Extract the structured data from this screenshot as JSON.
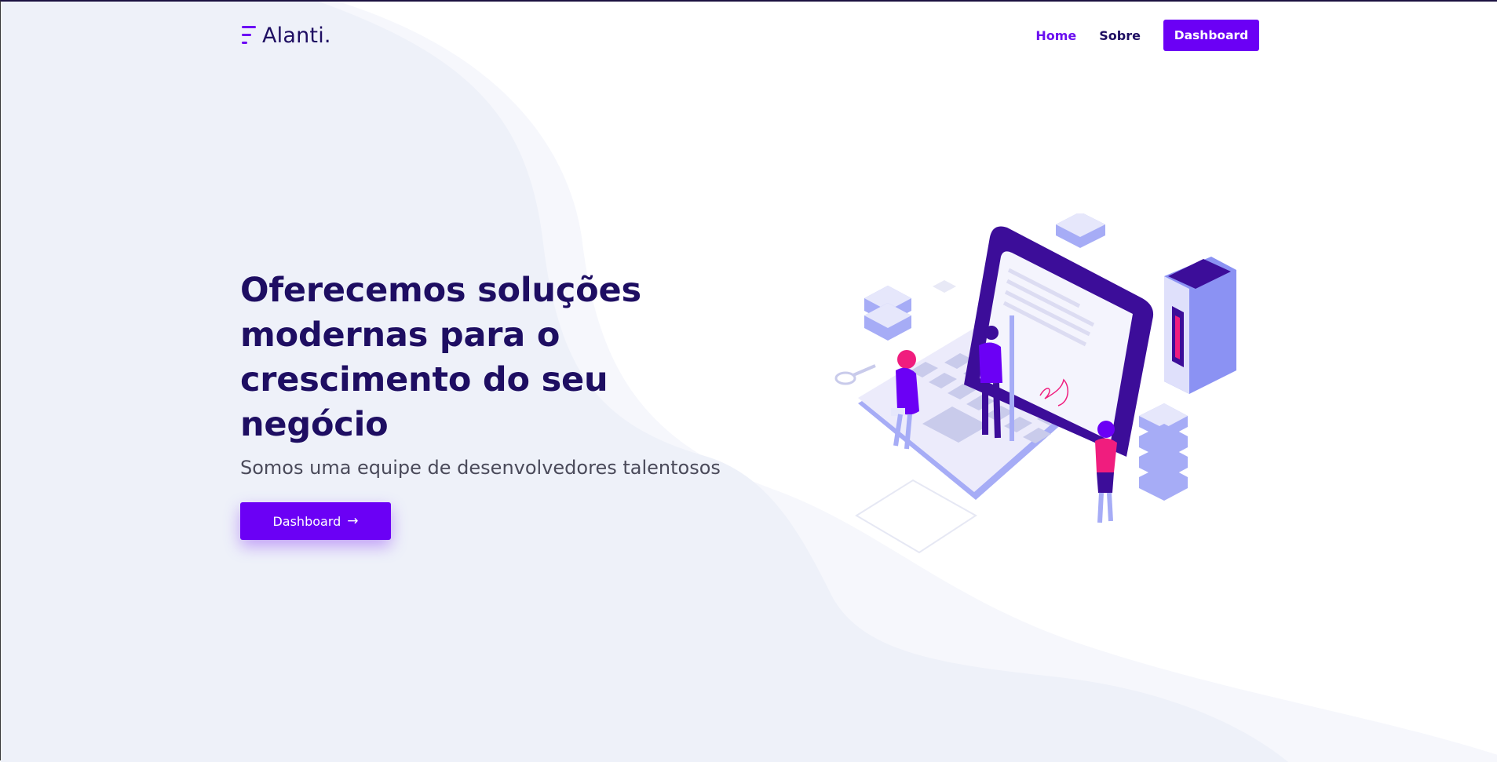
{
  "colors": {
    "primary": "#6b00f5",
    "heading": "#1e0e62",
    "text": "#4a4a5a",
    "wave_dark": "#eef1f9",
    "wave_light": "#f6f7fc"
  },
  "navbar": {
    "logo_text": "Alanti.",
    "links": [
      {
        "label": "Home",
        "active": true
      },
      {
        "label": "Sobre",
        "active": false
      }
    ],
    "cta_label": "Dashboard"
  },
  "hero": {
    "title": "Oferecemos soluções modernas para o crescimento do seu negócio",
    "subtitle": "Somos uma equipe de desenvolvedores talentosos",
    "cta_label": "Dashboard",
    "cta_icon": "arrow-right-icon"
  },
  "illustration": {
    "icon": "isometric-laptop-team-illustration"
  }
}
